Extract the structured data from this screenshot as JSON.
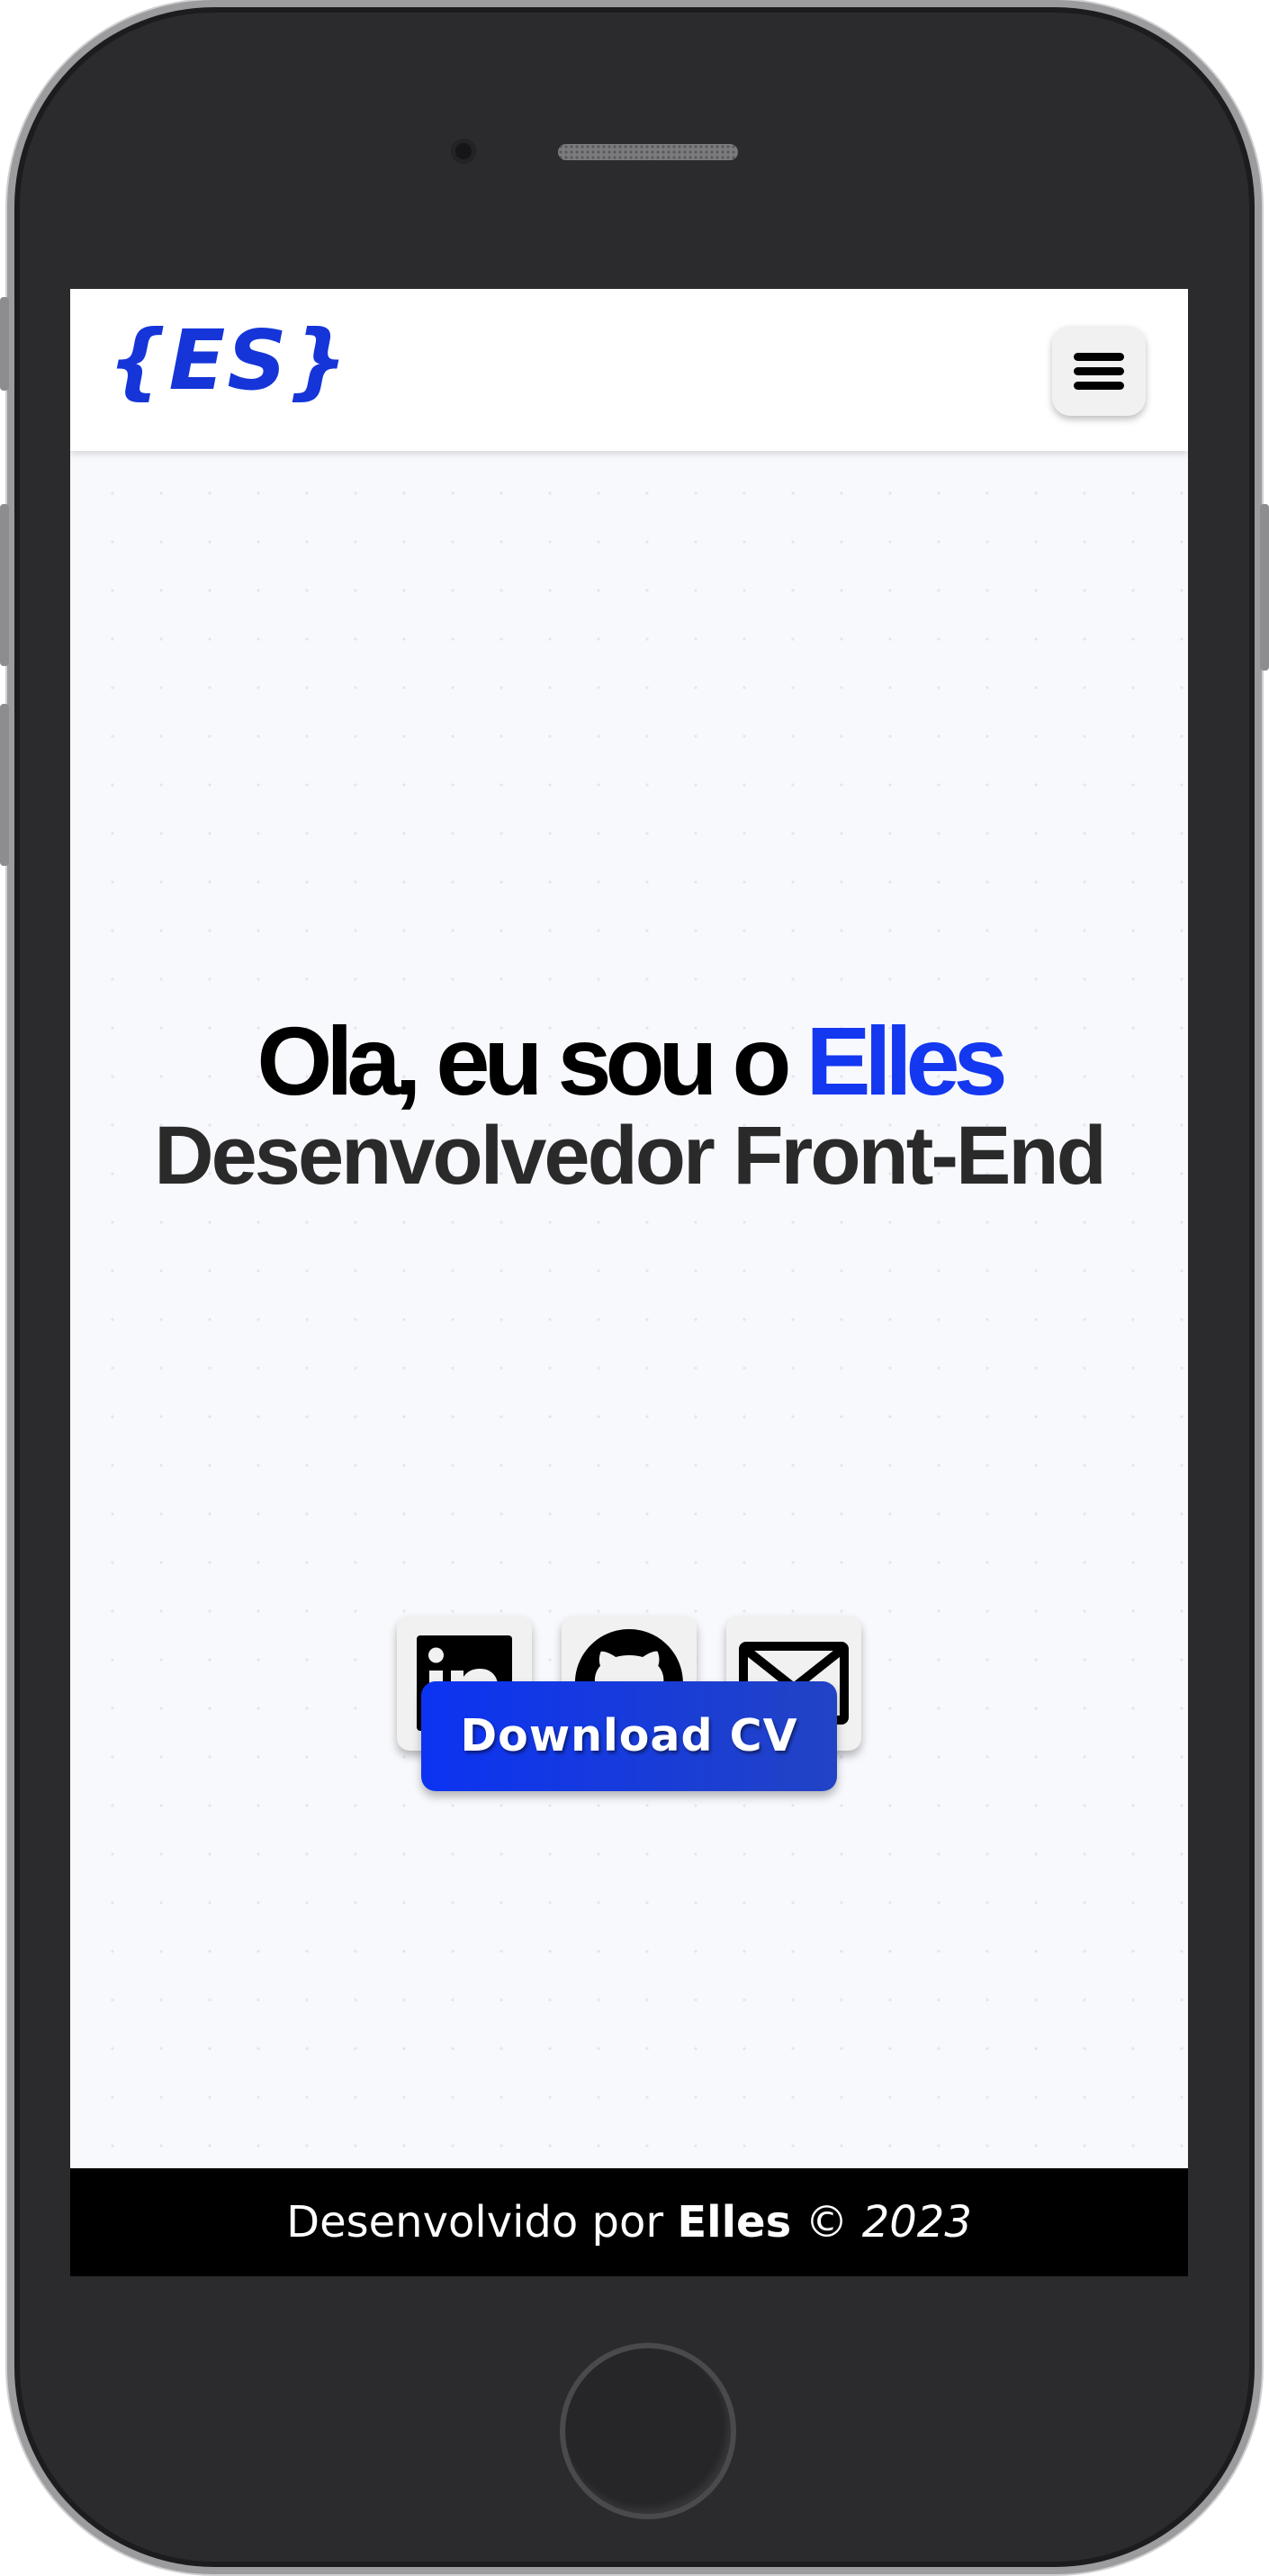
{
  "header": {
    "logo_text": "{ES}",
    "menu_icon": "hamburger-menu-icon"
  },
  "hero": {
    "greeting_prefix": "Ola, eu sou o",
    "name": "Elles",
    "role": "Desenvolvedor Front-End",
    "social_links": [
      {
        "icon": "linkedin-icon",
        "label": "LinkedIn"
      },
      {
        "icon": "github-icon",
        "label": "GitHub"
      },
      {
        "icon": "email-icon",
        "label": "Email"
      }
    ],
    "download_label": "Download CV"
  },
  "footer": {
    "prefix": "Desenvolvido por",
    "author": "Elles",
    "copyright": "©",
    "year": "2023"
  },
  "colors": {
    "accent": "#1437f0",
    "button_gradient_start": "#0c33f2",
    "button_gradient_end": "#2243c4",
    "footer_background": "#000000",
    "page_background": "#f8f9fd"
  }
}
